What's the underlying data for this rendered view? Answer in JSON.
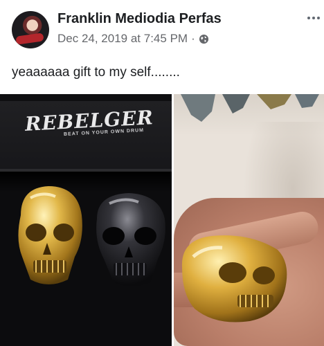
{
  "post": {
    "author": "Franklin Mediodia Perfas",
    "timestamp": "Dec 24, 2019 at 7:45 PM",
    "separator": "·",
    "audience_icon": "globe-icon",
    "text": "yeaaaaaa gift to my self........"
  },
  "photos": {
    "left": {
      "brand": "REBELGER",
      "tagline": "BEAT ON YOUR OWN DRUM"
    }
  },
  "colors": {
    "author": "#1c1e21",
    "meta": "#65676b",
    "gold": "#d4a838",
    "black_ring": "#1a1a1e"
  }
}
